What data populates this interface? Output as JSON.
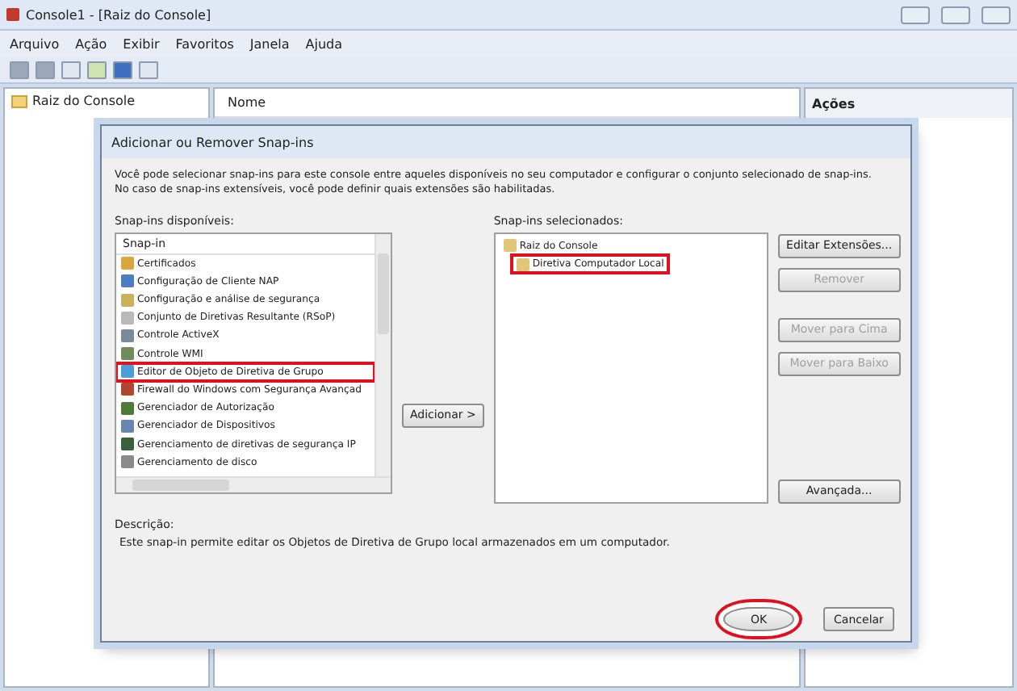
{
  "window": {
    "title": "Console1 - [Raiz do Console]"
  },
  "menu": [
    "Arquivo",
    "Ação",
    "Exibir",
    "Favoritos",
    "Janela",
    "Ajuda"
  ],
  "tree": [
    {
      "label": "Raiz do Console",
      "selected": false
    }
  ],
  "columns": [
    "Nome"
  ],
  "actions": {
    "title": "Ações"
  },
  "dialog": {
    "title": "Adicionar ou Remover Snap-ins",
    "intro": "Você pode selecionar snap-ins para este console entre aqueles disponíveis no seu computador e configurar o conjunto selecionado de snap-ins.\nNo caso de snap-ins extensíveis, você pode definir quais extensões são habilitadas.",
    "available_label": "Snap-ins disponíveis:",
    "available_header": "Snap-in",
    "available": [
      {
        "label": "Certificados",
        "annotated": false
      },
      {
        "label": "Configuração de Cliente NAP",
        "annotated": false
      },
      {
        "label": "Configuração e análise de segurança",
        "annotated": false
      },
      {
        "label": "Conjunto de Diretivas Resultante (RSoP)",
        "annotated": false
      },
      {
        "label": "Controle ActiveX",
        "annotated": false
      },
      {
        "label": "Controle WMI",
        "annotated": false
      },
      {
        "label": "Editor de Objeto de Diretiva de Grupo",
        "annotated": true
      },
      {
        "label": "Firewall do Windows com Segurança Avançad",
        "annotated": false
      },
      {
        "label": "Gerenciador de Autorização",
        "annotated": false
      },
      {
        "label": "Gerenciador de Dispositivos",
        "annotated": false
      },
      {
        "label": "Gerenciamento de diretivas de segurança IP",
        "annotated": false
      },
      {
        "label": "Gerenciamento de disco",
        "annotated": false
      }
    ],
    "add_button": "Adicionar >",
    "selected_label": "Snap-ins selecionados:",
    "selected_tree": [
      {
        "label": "Raiz do Console",
        "annotated": false,
        "children": [
          {
            "label": "Diretiva Computador Local",
            "annotated": true
          }
        ]
      }
    ],
    "side_buttons": [
      {
        "label": "Editar Extensões...",
        "disabled": false
      },
      {
        "label": "Remover",
        "disabled": true
      },
      {
        "label": "Mover para Cima",
        "disabled": true
      },
      {
        "label": "Mover para Baixo",
        "disabled": true
      }
    ],
    "advanced_button": "Avançada...",
    "description_label": "Descrição:",
    "description": "Este snap-in permite editar os Objetos de Diretiva de Grupo local armazenados em um computador.",
    "buttons": [
      {
        "label": "OK",
        "circled": true
      },
      {
        "label": "Cancelar",
        "circled": false
      }
    ]
  }
}
